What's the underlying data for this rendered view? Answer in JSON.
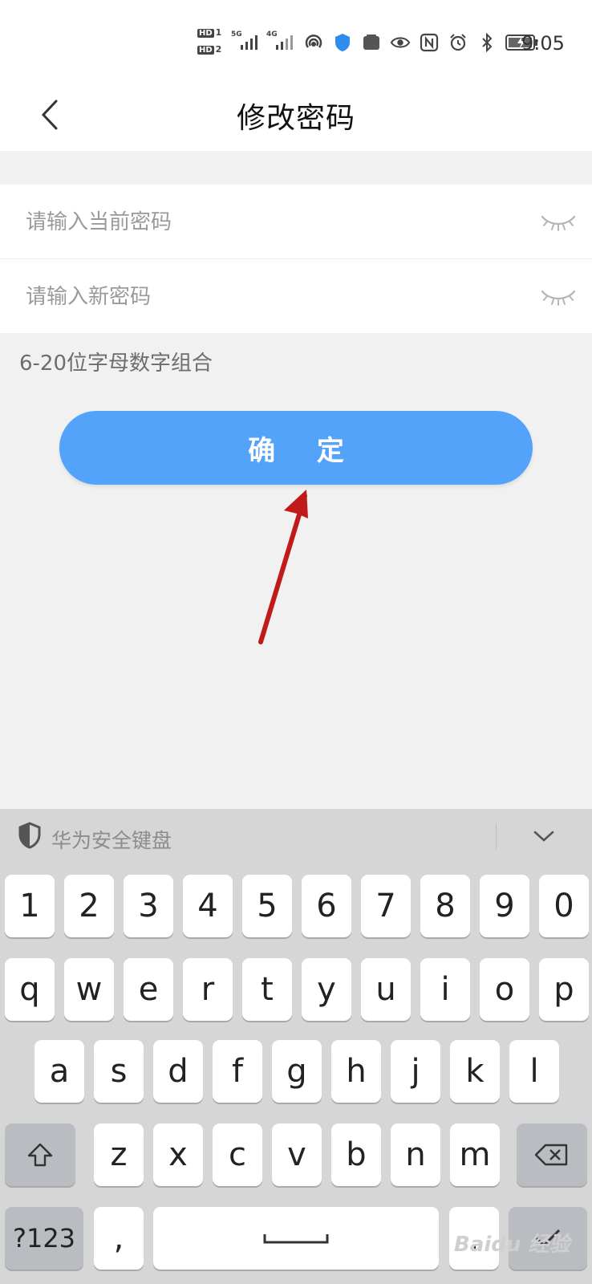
{
  "status_bar": {
    "hd1": "HD",
    "hd1_sim": "1",
    "hd2": "HD",
    "hd2_sim": "2",
    "net1": "5G",
    "net2": "4G",
    "time": "9:05"
  },
  "header": {
    "title": "修改密码"
  },
  "form": {
    "current_password_placeholder": "请输入当前密码",
    "new_password_placeholder": "请输入新密码",
    "hint": "6-20位字母数字组合",
    "confirm_label": "确 定"
  },
  "keyboard": {
    "title": "华为安全键盘",
    "row_numbers": [
      "1",
      "2",
      "3",
      "4",
      "5",
      "6",
      "7",
      "8",
      "9",
      "0"
    ],
    "row_qwerty": [
      "q",
      "w",
      "e",
      "r",
      "t",
      "y",
      "u",
      "i",
      "o",
      "p"
    ],
    "row_asdf": [
      "a",
      "s",
      "d",
      "f",
      "g",
      "h",
      "j",
      "k",
      "l"
    ],
    "row_zxcv": [
      "z",
      "x",
      "c",
      "v",
      "b",
      "n",
      "m"
    ],
    "symbols_label": "?123",
    "comma_label": ",",
    "period_label": "."
  },
  "watermark": "Baidu 经验",
  "colors": {
    "accent": "#54a3fb",
    "annotation_arrow": "#c01a1a"
  }
}
